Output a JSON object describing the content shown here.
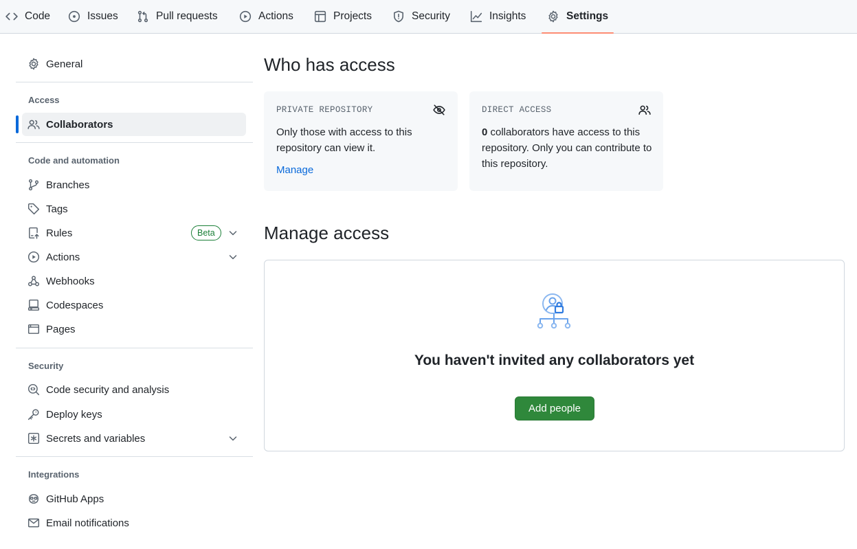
{
  "tabs": [
    {
      "label": "Code",
      "icon": "code-icon"
    },
    {
      "label": "Issues",
      "icon": "issue-opened-icon"
    },
    {
      "label": "Pull requests",
      "icon": "git-pull-request-icon"
    },
    {
      "label": "Actions",
      "icon": "play-icon"
    },
    {
      "label": "Projects",
      "icon": "table-icon"
    },
    {
      "label": "Security",
      "icon": "shield-icon"
    },
    {
      "label": "Insights",
      "icon": "graph-icon"
    },
    {
      "label": "Settings",
      "icon": "gear-icon",
      "active": true
    }
  ],
  "sidebar": {
    "general": {
      "label": "General",
      "icon": "gear-icon"
    },
    "sections": {
      "access": {
        "heading": "Access",
        "items": [
          {
            "label": "Collaborators",
            "icon": "people-icon",
            "selected": true
          }
        ]
      },
      "code_automation": {
        "heading": "Code and automation",
        "items": [
          {
            "label": "Branches",
            "icon": "git-branch-icon"
          },
          {
            "label": "Tags",
            "icon": "tag-icon"
          },
          {
            "label": "Rules",
            "icon": "repo-push-icon",
            "badge": "Beta",
            "expandable": true
          },
          {
            "label": "Actions",
            "icon": "play-icon",
            "expandable": true
          },
          {
            "label": "Webhooks",
            "icon": "webhook-icon"
          },
          {
            "label": "Codespaces",
            "icon": "codespaces-icon"
          },
          {
            "label": "Pages",
            "icon": "browser-icon"
          }
        ]
      },
      "security": {
        "heading": "Security",
        "items": [
          {
            "label": "Code security and analysis",
            "icon": "codescan-icon"
          },
          {
            "label": "Deploy keys",
            "icon": "key-icon"
          },
          {
            "label": "Secrets and variables",
            "icon": "key-asterisk-icon",
            "expandable": true
          }
        ]
      },
      "integrations": {
        "heading": "Integrations",
        "items": [
          {
            "label": "GitHub Apps",
            "icon": "copilot-icon"
          },
          {
            "label": "Email notifications",
            "icon": "mail-icon"
          }
        ]
      }
    }
  },
  "main": {
    "who_has_access": {
      "title": "Who has access",
      "private_card": {
        "title": "PRIVATE REPOSITORY",
        "icon": "eye-closed-icon",
        "text": "Only those with access to this repository can view it.",
        "link": "Manage"
      },
      "direct_card": {
        "title": "DIRECT ACCESS",
        "icon": "people-icon",
        "count": "0",
        "text": " collaborators have access to this repository. Only you can contribute to this repository."
      }
    },
    "manage_access": {
      "title": "Manage access",
      "empty_icon": "person-lock-org-icon",
      "empty_text": "You haven't invited any collaborators yet",
      "button": "Add people"
    }
  },
  "colors": {
    "accent_blue": "#0969da",
    "active_tab_underline": "#fd8c73",
    "primary_button": "#2f883b",
    "beta_badge": "#1a7f37",
    "muted_text": "#59636e"
  }
}
